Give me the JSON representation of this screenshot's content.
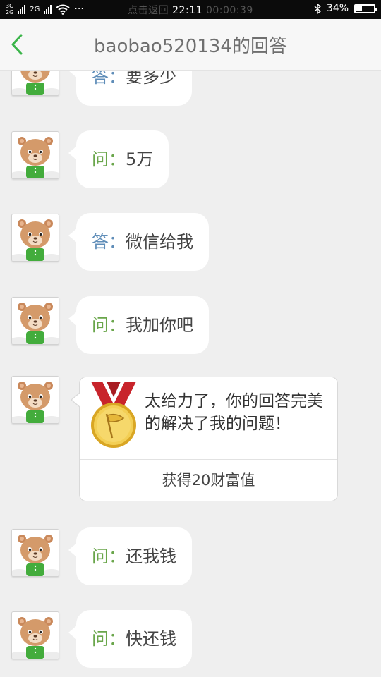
{
  "status_bar": {
    "net_top": "3G",
    "net_bottom": "2G",
    "net2": "2G",
    "more": "···",
    "ghost_left": "点击返回",
    "time": "22:11",
    "ghost_right": "00:00:39",
    "battery_percent": "34%",
    "battery_level": 0.34,
    "icons": [
      "signal-icon",
      "wifi-icon",
      "bluetooth-icon",
      "battery-icon"
    ]
  },
  "header": {
    "title": "baobao520134的回答",
    "back_icon": "chevron-left-icon",
    "accent_color": "#3bb54a"
  },
  "messages": [
    {
      "tag": "答：",
      "text": "要多少"
    },
    {
      "tag": "问：",
      "text": "5万"
    },
    {
      "tag": "答：",
      "text": "微信给我"
    },
    {
      "tag": "问：",
      "text": "我加你吧"
    },
    {
      "tag": "问：",
      "text": "还我钱"
    },
    {
      "tag": "问：",
      "text": "快还钱"
    }
  ],
  "praise_card": {
    "text": "太给力了，你的回答完美的解决了我的问题！",
    "reward": "获得20财富值",
    "medal_icon": "gold-medal-icon"
  },
  "colors": {
    "question_tag": "#6aa64b",
    "answer_tag": "#5f8db8",
    "background": "#efefef"
  }
}
